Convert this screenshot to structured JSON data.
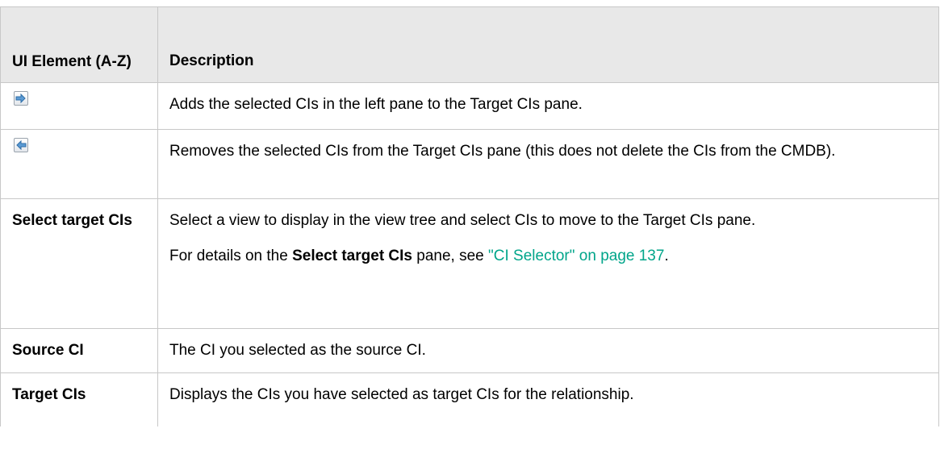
{
  "table": {
    "headers": {
      "element": "UI Element (A-Z)",
      "description": "Description"
    },
    "rows": [
      {
        "icon": "arrow-right-icon",
        "description": "Adds the selected CIs in the left pane to the Target CIs pane."
      },
      {
        "icon": "arrow-left-icon",
        "description": "Removes the selected CIs from the Target CIs pane (this does not delete the CIs from the CMDB)."
      },
      {
        "name": "Select target CIs",
        "description": "Select a view to display in the view tree and select CIs to move to the Target CIs pane.",
        "details_prefix": "For details on the ",
        "details_bold": "Select target CIs",
        "details_middle": " pane, see ",
        "details_link": "\"CI Selector\" on page 137",
        "details_suffix": "."
      },
      {
        "name": "Source CI",
        "description": "The CI you selected as the source CI."
      },
      {
        "name": "Target CIs",
        "description": "Displays the CIs you have selected as target CIs for the relationship."
      }
    ]
  },
  "colors": {
    "header_bg": "#e8e8e8",
    "border": "#c8c8c8",
    "link": "#00a58a"
  }
}
